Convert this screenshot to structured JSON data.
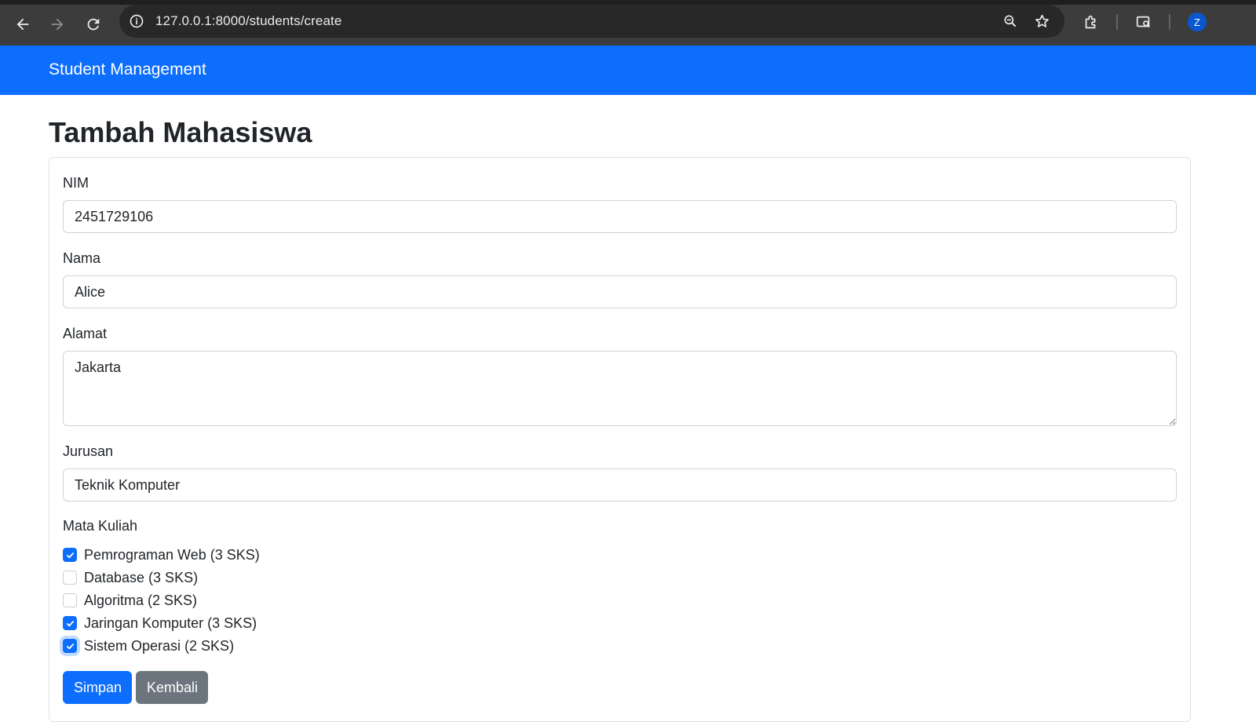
{
  "browser": {
    "url": "127.0.0.1:8000/students/create",
    "profile_initial": "Z",
    "icons": [
      "back-arrow-icon",
      "forward-arrow-icon",
      "reload-icon",
      "site-info-icon",
      "zoom-icon",
      "bookmark-star-icon",
      "extensions-icon",
      "tab-search-icon"
    ]
  },
  "navbar": {
    "brand": "Student Management",
    "color": "#0d6efd"
  },
  "page": {
    "title": "Tambah Mahasiswa"
  },
  "form": {
    "nim": {
      "label": "NIM",
      "value": "2451729106"
    },
    "nama": {
      "label": "Nama",
      "value": "Alice"
    },
    "alamat": {
      "label": "Alamat",
      "value": "Jakarta"
    },
    "jurusan": {
      "label": "Jurusan",
      "value": "Teknik Komputer"
    },
    "mata_kuliah": {
      "label": "Mata Kuliah",
      "options": [
        {
          "label": "Pemrograman Web (3 SKS)",
          "checked": true
        },
        {
          "label": "Database (3 SKS)",
          "checked": false
        },
        {
          "label": "Algoritma (2 SKS)",
          "checked": false
        },
        {
          "label": "Jaringan Komputer (3 SKS)",
          "checked": true
        },
        {
          "label": "Sistem Operasi (2 SKS)",
          "checked": true
        }
      ]
    },
    "buttons": {
      "save": "Simpan",
      "back": "Kembali"
    }
  }
}
